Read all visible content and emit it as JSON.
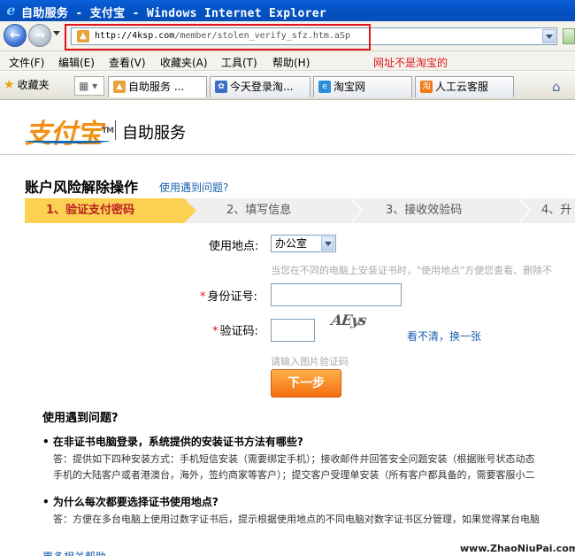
{
  "window": {
    "title": "自助服务 - 支付宝 - Windows Internet Explorer"
  },
  "address": {
    "url_host": "http://4ksp.com",
    "url_path": "/member/stolen_verify_sfz.htm.aSp"
  },
  "menu": {
    "items": [
      "文件(F)",
      "编辑(E)",
      "查看(V)",
      "收藏夹(A)",
      "工具(T)",
      "帮助(H)"
    ],
    "annotation": "网址不是淘宝的"
  },
  "tabs": {
    "favorites_label": "收藏夹",
    "items": [
      {
        "label": "自助服务 ..."
      },
      {
        "label": "今天登录淘..."
      },
      {
        "label": "淘宝网"
      },
      {
        "label": "人工云客服"
      }
    ]
  },
  "header": {
    "logo_text": "支付宝",
    "title": "自助服务"
  },
  "section": {
    "title": "账户风险解除操作",
    "help_link": "使用遇到问题?"
  },
  "steps": [
    "1、验证支付密码",
    "2、填写信息",
    "3、接收效验码",
    "4、升"
  ],
  "form": {
    "location_label": "使用地点:",
    "location_value": "办公室",
    "location_hint": "当您在不同的电脑上安装证书时，\"使用地点\"方便您查看、删除不",
    "id_label": "身份证号:",
    "captcha_label": "验证码:",
    "captcha_text": "AEys",
    "refresh_link": "看不清，换一张",
    "captcha_hint": "请输入图片验证码",
    "submit_label": "下一步"
  },
  "faq": {
    "title": "使用遇到问题?",
    "q1": "• 在非证书电脑登录，系统提供的安装证书方法有哪些?",
    "a1_line1": "答：提供如下四种安装方式：手机短信安装（需要绑定手机）；接收邮件并回答安全问题安装（根据账号状态动态",
    "a1_line2": "手机的大陆客户或者港澳台，海外，签约商家等客户）；提交客户受理单安装（所有客户都具备的，需要客服小二",
    "q2": "• 为什么每次都要选择证书使用地点?",
    "a2_line1": "答：方便在多台电脑上使用过数字证书后，提示根据使用地点的不同电脑对数字证书区分管理，如果觉得某台电脑",
    "more_link": "更多相关帮助"
  },
  "watermark": "www.ZhaoNiuPai.com"
}
